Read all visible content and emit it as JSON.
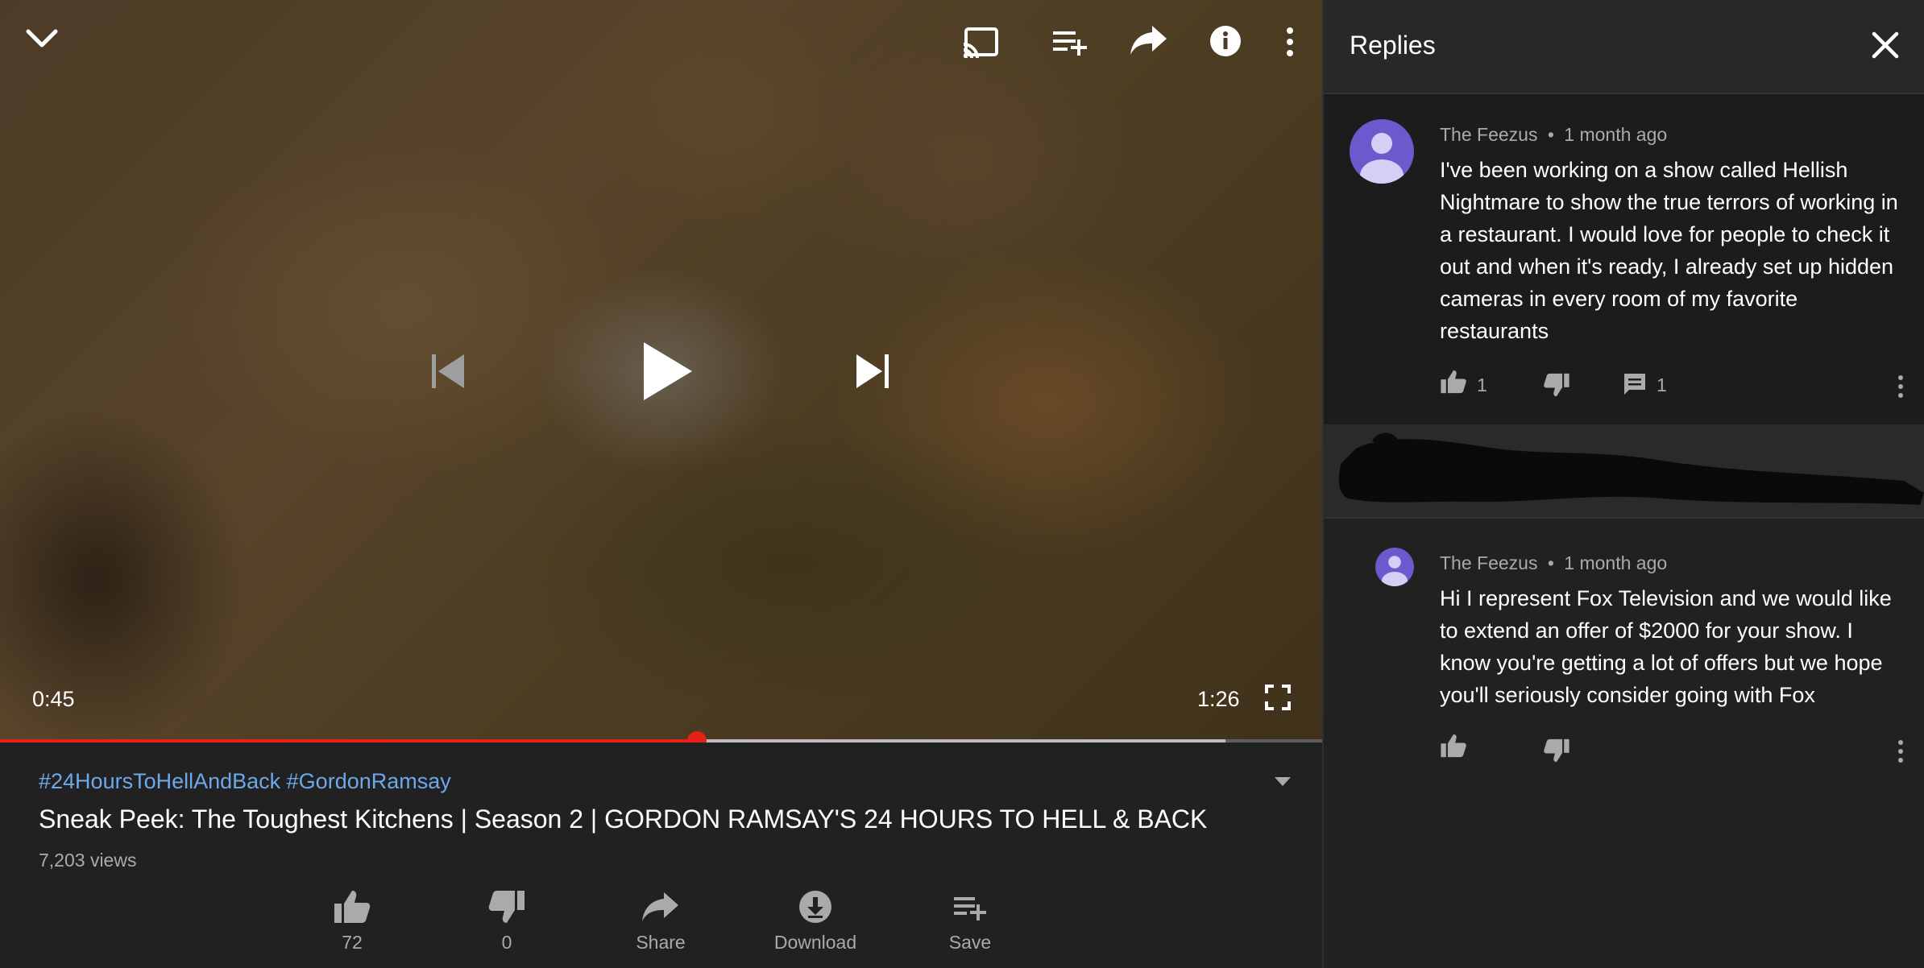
{
  "player": {
    "current_time": "0:45",
    "duration": "1:26",
    "progress_played": 0.527,
    "progress_buffered": 0.927,
    "icons": {
      "collapse": "chevron-down-icon",
      "cast": "cast-icon",
      "add_to_queue": "playlist-add-icon",
      "share": "share-icon",
      "info": "info-icon",
      "more": "more-vert-icon",
      "previous": "skip-previous-icon",
      "play": "play-icon",
      "next": "skip-next-icon",
      "fullscreen": "fullscreen-icon"
    },
    "colors": {
      "progress": "#e62117"
    }
  },
  "video": {
    "hashtags": "#24HoursToHellAndBack #GordonRamsay",
    "title": "Sneak Peek: The Toughest Kitchens | Season 2 | GORDON RAMSAY'S 24 HOURS TO HELL & BACK",
    "views": "7,203 views",
    "actions": [
      {
        "label": "72",
        "icon": "thumb-up-icon"
      },
      {
        "label": "0",
        "icon": "thumb-down-icon"
      },
      {
        "label": "Share",
        "icon": "share-icon"
      },
      {
        "label": "Download",
        "icon": "download-icon"
      },
      {
        "label": "Save",
        "icon": "playlist-add-icon"
      }
    ],
    "colors": {
      "hashtag": "#6ea8ea"
    }
  },
  "replies_panel": {
    "title": "Replies",
    "parent_comment": {
      "author": "The Feezus",
      "time": "1 month ago",
      "text": "I've been working on a show called Hellish Nightmare to show the true terrors of working in a restaurant. I would love for people to check it out and when it's ready, I already set up hidden cameras in every room of my favorite restaurants",
      "likes": "1",
      "replies": "1"
    },
    "reply": {
      "author": "The Feezus",
      "time": "1 month ago",
      "text": "Hi I represent Fox Television and we would like to extend an offer of $2000 for your show. I know you're getting a lot of offers but we hope you'll seriously consider going with Fox"
    },
    "separator": "•"
  }
}
